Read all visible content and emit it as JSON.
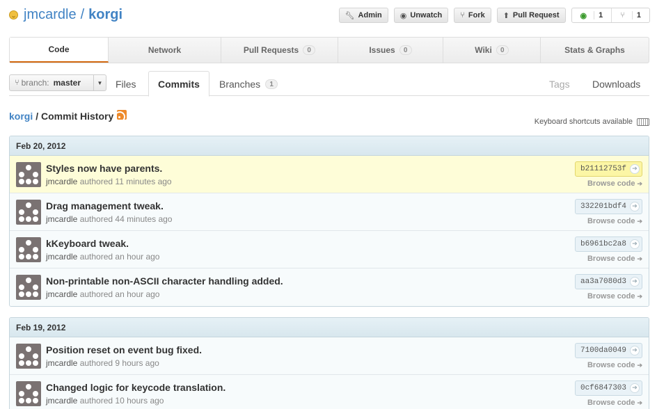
{
  "repo": {
    "owner": "jmcardle",
    "separator": "/",
    "name": "korgi"
  },
  "actions": {
    "admin": "Admin",
    "unwatch": "Unwatch",
    "fork": "Fork",
    "pull_request": "Pull Request",
    "watchers": "1",
    "forks": "1"
  },
  "tabs": [
    {
      "label": "Code",
      "count": null
    },
    {
      "label": "Network",
      "count": null
    },
    {
      "label": "Pull Requests",
      "count": "0"
    },
    {
      "label": "Issues",
      "count": "0"
    },
    {
      "label": "Wiki",
      "count": "0"
    },
    {
      "label": "Stats & Graphs",
      "count": null
    }
  ],
  "subnav": {
    "branch_label": "branch:",
    "branch_value": "master",
    "files": "Files",
    "commits": "Commits",
    "branches": "Branches",
    "branches_count": "1",
    "tags": "Tags",
    "downloads": "Downloads"
  },
  "title": {
    "repo": "korgi",
    "text": "/ Commit History"
  },
  "keyboard_hint": "Keyboard shortcuts available",
  "groups": [
    {
      "date": "Feb 20, 2012",
      "commits": [
        {
          "message": "Styles now have parents.",
          "author": "jmcardle",
          "verb": "authored",
          "time": "11 minutes ago",
          "sha": "b21112753f",
          "browse": "Browse code"
        },
        {
          "message": "Drag management tweak.",
          "author": "jmcardle",
          "verb": "authored",
          "time": "44 minutes ago",
          "sha": "332201bdf4",
          "browse": "Browse code"
        },
        {
          "message": "kKeyboard tweak.",
          "author": "jmcardle",
          "verb": "authored",
          "time": "an hour ago",
          "sha": "b6961bc2a8",
          "browse": "Browse code"
        },
        {
          "message": "Non-printable non-ASCII character handling added.",
          "author": "jmcardle",
          "verb": "authored",
          "time": "an hour ago",
          "sha": "aa3a7080d3",
          "browse": "Browse code"
        }
      ]
    },
    {
      "date": "Feb 19, 2012",
      "commits": [
        {
          "message": "Position reset on event bug fixed.",
          "author": "jmcardle",
          "verb": "authored",
          "time": "9 hours ago",
          "sha": "7100da0049",
          "browse": "Browse code"
        },
        {
          "message": "Changed logic for keycode translation.",
          "author": "jmcardle",
          "verb": "authored",
          "time": "10 hours ago",
          "sha": "0cf6847303",
          "browse": "Browse code"
        }
      ]
    }
  ],
  "colors": {
    "link": "#4183c4",
    "accent": "#d26911",
    "highlight": "#fefdd8"
  }
}
